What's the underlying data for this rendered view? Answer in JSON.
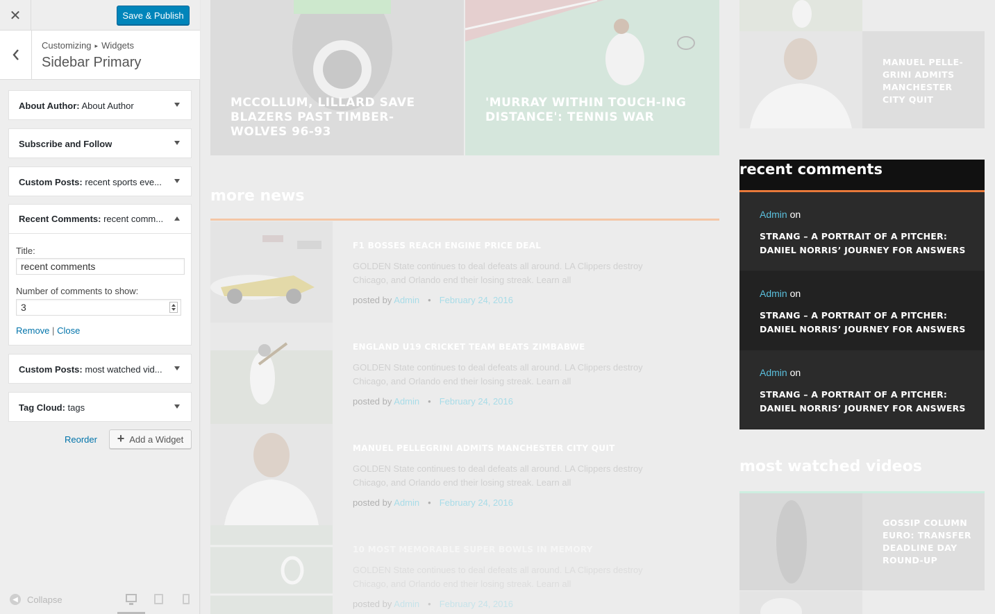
{
  "customizer": {
    "publish_label": "Save & Publish",
    "breadcrumb": [
      "Customizing",
      "Widgets"
    ],
    "section_title": "Sidebar Primary",
    "widgets": [
      {
        "type": "About Author:",
        "name": "About Author"
      },
      {
        "type": "Subscribe and Follow",
        "name": ""
      },
      {
        "type": "Custom Posts:",
        "name": "recent sports eve..."
      },
      {
        "type": "Recent Comments:",
        "name": "recent comm..."
      },
      {
        "type": "Custom Posts:",
        "name": "most watched vid..."
      },
      {
        "type": "Tag Cloud:",
        "name": "tags"
      }
    ],
    "expanded_widget": {
      "title_label": "Title:",
      "title_value": "recent comments",
      "count_label": "Number of comments to show:",
      "count_value": "3",
      "remove_label": "Remove",
      "separator": "|",
      "close_label": "Close"
    },
    "reorder_label": "Reorder",
    "add_widget_label": "Add a Widget",
    "collapse_label": "Collapse"
  },
  "preview": {
    "featured": [
      {
        "title": "MCCOLLUM, LILLARD SAVE BLAZERS PAST TIMBER-WOLVES 96-93"
      },
      {
        "title": "'MURRAY WITHIN TOUCH-ING DISTANCE': TENNIS WAR"
      }
    ],
    "side_top_post": "MANUEL PELLE-GRINI ADMITS MANCHESTER CITY QUIT",
    "more_news_heading": "more news",
    "news": [
      {
        "title": "F1 BOSSES REACH ENGINE PRICE DEAL",
        "excerpt": "GOLDEN State continues to deal defeats all around. LA Clippers destroy Chicago, and Orlando end their losing streak. Learn all",
        "posted_by": "posted by",
        "author": "Admin",
        "date": "February 24, 2016"
      },
      {
        "title": "ENGLAND U19 CRICKET TEAM BEATS ZIMBABWE",
        "excerpt": "GOLDEN State continues to deal defeats all around. LA Clippers destroy Chicago, and Orlando end their losing streak. Learn all",
        "posted_by": "posted by",
        "author": "Admin",
        "date": "February 24, 2016"
      },
      {
        "title": "MANUEL PELLEGRINI ADMITS MANCHESTER CITY QUIT",
        "excerpt": "GOLDEN State continues to deal defeats all around. LA Clippers destroy Chicago, and Orlando end their losing streak. Learn all",
        "posted_by": "posted by",
        "author": "Admin",
        "date": "February 24, 2016"
      },
      {
        "title": "10 MOST MEMORABLE SUPER BOWLS IN MEMORY",
        "excerpt": "GOLDEN State continues to deal defeats all around. LA Clippers destroy Chicago, and Orlando end their losing streak. Learn all",
        "posted_by": "posted by",
        "author": "Admin",
        "date": "February 24, 2016"
      }
    ],
    "recent_comments": {
      "heading": "recent comments",
      "items": [
        {
          "author": "Admin",
          "on": "on",
          "post": "STRANG – A PORTRAIT OF A PITCHER: DANIEL NORRIS’ JOURNEY FOR ANSWERS"
        },
        {
          "author": "Admin",
          "on": "on",
          "post": "STRANG – A PORTRAIT OF A PITCHER: DANIEL NORRIS’ JOURNEY FOR ANSWERS"
        },
        {
          "author": "Admin",
          "on": "on",
          "post": "STRANG – A PORTRAIT OF A PITCHER: DANIEL NORRIS’ JOURNEY FOR ANSWERS"
        }
      ]
    },
    "most_watched": {
      "heading": "most watched videos",
      "first_post": "GOSSIP COLUMN EURO: TRANSFER DEADLINE DAY ROUND-UP"
    }
  },
  "colors": {
    "primary_button": "#0085ba",
    "link": "#0073aa",
    "accent_orange": "#e8793a",
    "comment_link": "#5bc0de"
  }
}
